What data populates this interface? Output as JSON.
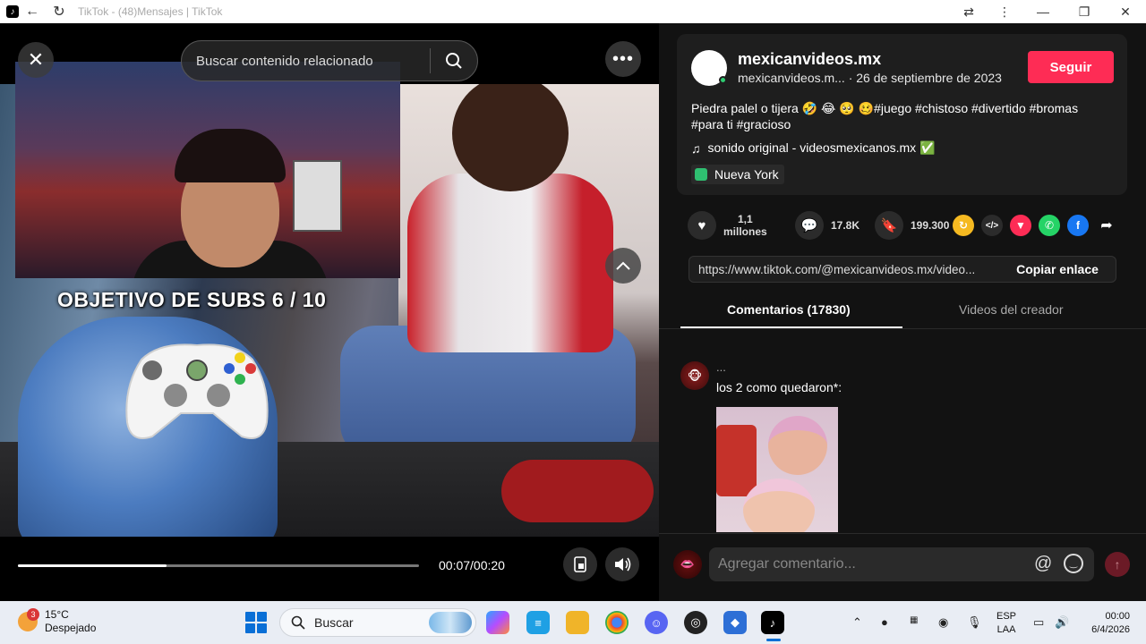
{
  "window": {
    "title": "TikTok - (48)Mensajes | TikTok"
  },
  "video": {
    "search_placeholder": "Buscar contenido relacionado",
    "overlay_text": "OBJETIVO DE SUBS 6 / 10",
    "progress_fraction": 0.37,
    "time": "00:07/00:20"
  },
  "author": {
    "name": "mexicanvideos.mx",
    "handle_date": "mexicanvideos.m...  · 26 de septiembre de 2023",
    "follow_label": "Seguir"
  },
  "post": {
    "description": "Piedra palel o tijera 🤣 😂 🥺 🥴#juego #chistoso #divertido #bromas #para ti #gracioso",
    "music": "sonido original - videosmexicanos.mx ✅",
    "location": "Nueva York"
  },
  "stats": {
    "likes": "1,1\nmillones",
    "comments": "17.8K",
    "saves": "199.300"
  },
  "link": {
    "url": "https://www.tiktok.com/@mexicanvideos.mx/video...",
    "copy_label": "Copiar enlace"
  },
  "tabs": {
    "comments": "Comentarios (17830)",
    "creator_videos": "Videos del creador"
  },
  "comment": {
    "user": "...",
    "text": "los 2 como quedaron*:"
  },
  "composer": {
    "placeholder": "Agregar comentario..."
  },
  "taskbar": {
    "weather_temp": "15°C",
    "weather_desc": "Despejado",
    "weather_badge": "3",
    "search_label": "Buscar",
    "lang_line1": "ESP",
    "lang_line2": "LAA",
    "time": "00:00",
    "date": "6/4/2026"
  },
  "colors": {
    "accent": "#fe2c55",
    "background": "#121212"
  }
}
